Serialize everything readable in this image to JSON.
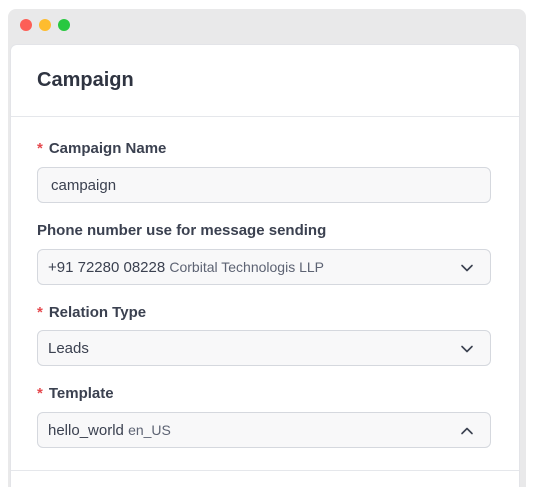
{
  "window": {
    "controls": [
      "close",
      "minimize",
      "maximize"
    ]
  },
  "card": {
    "title": "Campaign"
  },
  "fields": {
    "campaign_name": {
      "required": "*",
      "label": "Campaign Name",
      "value": "campaign"
    },
    "phone_number": {
      "label": "Phone number use for message sending",
      "value": "+91 72280 08228",
      "secondary": "Corbital Technologis LLP",
      "icon": "chevron-down-icon"
    },
    "relation_type": {
      "required": "*",
      "label": "Relation Type",
      "value": "Leads",
      "icon": "chevron-down-icon"
    },
    "template": {
      "required": "*",
      "label": "Template",
      "value": "hello_world",
      "secondary": "en_US",
      "icon": "chevron-up-icon"
    }
  },
  "colors": {
    "close": "#fd5f57",
    "minimize": "#febc2e",
    "maximize": "#28c840",
    "required": "#e5484d"
  }
}
